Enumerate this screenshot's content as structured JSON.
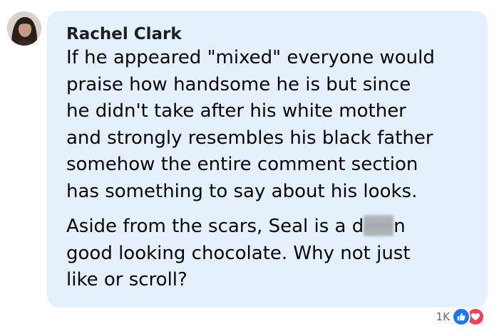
{
  "comment": {
    "author": "Rachel Clark",
    "paragraphs": [
      "If he appeared \"mixed\" everyone would\npraise how handsome he is but since\nhe didn't take after his white mother\nand strongly resembles his black father\nsomehow the entire comment section\nhas something to say about his looks."
    ],
    "paragraph2_before": "Aside from the scars, Seal is a d",
    "paragraph2_after": "n\ngood looking chocolate. Why not just\nlike or scroll?",
    "reaction_count": "1K"
  },
  "icons": {
    "avatar": "profile-photo",
    "reactions": [
      "like-icon",
      "love-icon"
    ]
  },
  "colors": {
    "bubble": "#e5f0fd",
    "like": "#1877f2",
    "love": "#f33e58",
    "count": "#65676b"
  }
}
